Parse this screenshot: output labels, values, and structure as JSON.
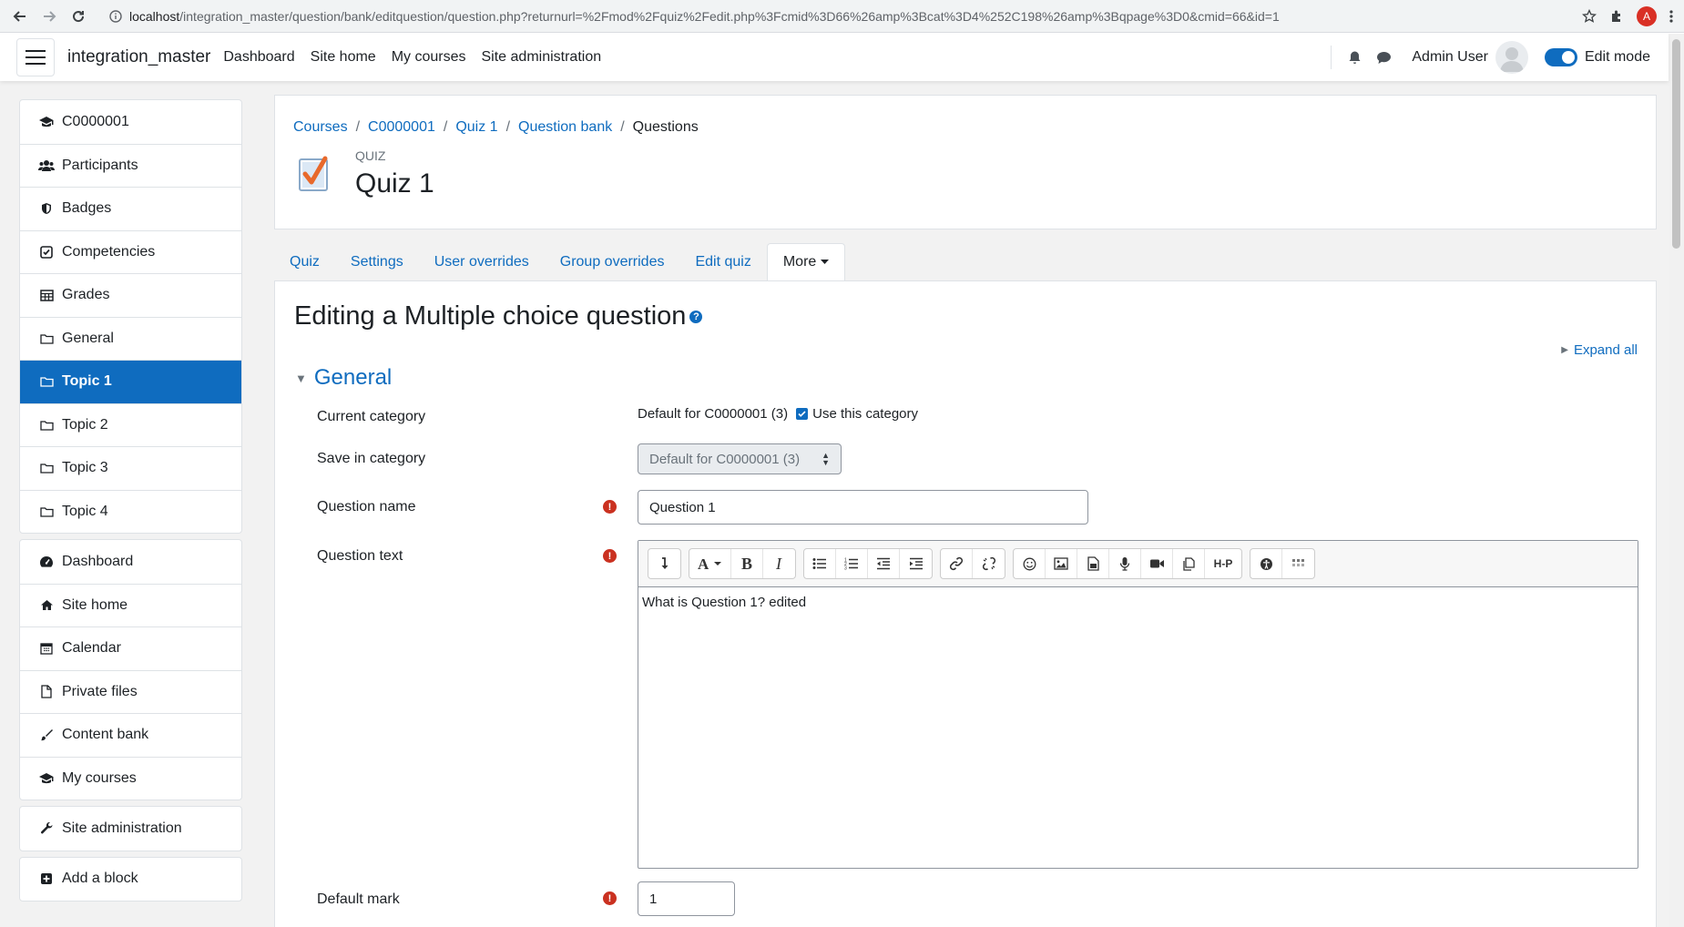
{
  "browser": {
    "url_host": "localhost",
    "url_path": "/integration_master/question/bank/editquestion/question.php?returnurl=%2Fmod%2Fquiz%2Fedit.php%3Fcmid%3D66%26amp%3Bcat%3D4%252C198%26amp%3Bqpage%3D0&cmid=66&id=1",
    "profile_initial": "A"
  },
  "navbar": {
    "site_name": "integration_master",
    "links": [
      "Dashboard",
      "Site home",
      "My courses",
      "Site administration"
    ],
    "user_name": "Admin User",
    "edit_mode_label": "Edit mode",
    "edit_mode_on": true
  },
  "drawer": {
    "course_items": [
      {
        "label": "C0000001",
        "icon": "graduation-cap-icon"
      },
      {
        "label": "Participants",
        "icon": "users-icon"
      },
      {
        "label": "Badges",
        "icon": "shield-icon"
      },
      {
        "label": "Competencies",
        "icon": "check-square-icon"
      },
      {
        "label": "Grades",
        "icon": "table-icon"
      },
      {
        "label": "General",
        "icon": "folder-icon"
      },
      {
        "label": "Topic 1",
        "icon": "folder-icon",
        "active": true
      },
      {
        "label": "Topic 2",
        "icon": "folder-icon"
      },
      {
        "label": "Topic 3",
        "icon": "folder-icon"
      },
      {
        "label": "Topic 4",
        "icon": "folder-icon"
      }
    ],
    "site_items": [
      {
        "label": "Dashboard",
        "icon": "tachometer-icon"
      },
      {
        "label": "Site home",
        "icon": "home-icon"
      },
      {
        "label": "Calendar",
        "icon": "calendar-icon"
      },
      {
        "label": "Private files",
        "icon": "file-icon"
      },
      {
        "label": "Content bank",
        "icon": "paintbrush-icon"
      },
      {
        "label": "My courses",
        "icon": "graduation-cap-icon"
      }
    ],
    "admin_item": {
      "label": "Site administration",
      "icon": "wrench-icon"
    },
    "add_block": {
      "label": "Add a block",
      "icon": "plus-square-icon"
    }
  },
  "header": {
    "breadcrumb": [
      "Courses",
      "C0000001",
      "Quiz 1",
      "Question bank",
      "Questions"
    ],
    "module_type": "QUIZ",
    "title": "Quiz 1"
  },
  "secondary_nav": {
    "tabs": [
      "Quiz",
      "Settings",
      "User overrides",
      "Group overrides",
      "Edit quiz"
    ],
    "more_label": "More"
  },
  "form": {
    "heading": "Editing a Multiple choice question",
    "expand_all": "Expand all",
    "section": "General",
    "current_category_label": "Current category",
    "current_category_value": "Default for C0000001 (3)",
    "use_category_label": "Use this category",
    "use_category_checked": true,
    "save_in_category_label": "Save in category",
    "save_in_category_value": "Default for C0000001 (3)",
    "question_name_label": "Question name",
    "question_name_value": "Question 1",
    "question_text_label": "Question text",
    "question_text_value": "What is Question 1? edited",
    "default_mark_label": "Default mark",
    "default_mark_value": "1"
  },
  "colors": {
    "accent": "#0f6cbf",
    "required": "#ca3120",
    "page_bg": "#f2f2f2"
  }
}
